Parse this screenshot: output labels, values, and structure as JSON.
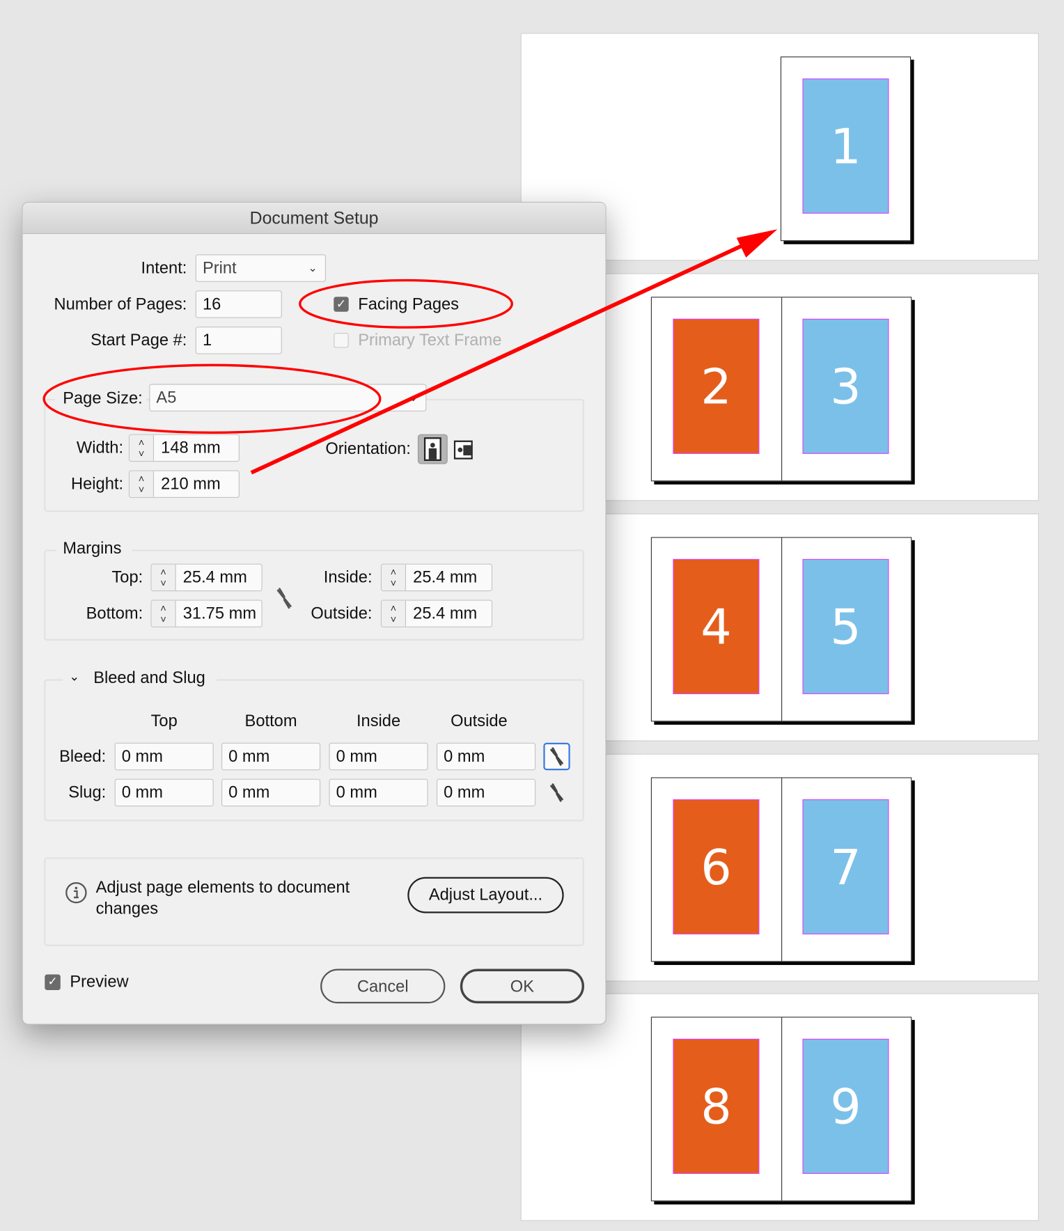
{
  "dialog": {
    "title": "Document Setup",
    "intent": {
      "label": "Intent:",
      "value": "Print"
    },
    "number_of_pages": {
      "label": "Number of Pages:",
      "value": "16"
    },
    "start_page": {
      "label": "Start Page #:",
      "value": "1"
    },
    "facing_pages": {
      "label": "Facing Pages",
      "checked": true
    },
    "primary_text_frame": {
      "label": "Primary Text Frame",
      "checked": false,
      "disabled": true
    },
    "page_size": {
      "label": "Page Size:",
      "value": "A5"
    },
    "width": {
      "label": "Width:",
      "value": "148 mm"
    },
    "height": {
      "label": "Height:",
      "value": "210 mm"
    },
    "orientation": {
      "label": "Orientation:",
      "selected": "portrait"
    },
    "margins": {
      "title": "Margins",
      "top": {
        "label": "Top:",
        "value": "25.4 mm"
      },
      "bottom": {
        "label": "Bottom:",
        "value": "31.75 mm"
      },
      "inside": {
        "label": "Inside:",
        "value": "25.4 mm"
      },
      "outside": {
        "label": "Outside:",
        "value": "25.4 mm"
      }
    },
    "bleed_slug": {
      "title": "Bleed and Slug",
      "columns": [
        "Top",
        "Bottom",
        "Inside",
        "Outside"
      ],
      "bleed": {
        "label": "Bleed:",
        "values": [
          "0 mm",
          "0 mm",
          "0 mm",
          "0 mm"
        ]
      },
      "slug": {
        "label": "Slug:",
        "values": [
          "0 mm",
          "0 mm",
          "0 mm",
          "0 mm"
        ]
      }
    },
    "adjust": {
      "line1": "Adjust page elements to document",
      "line2": "changes",
      "button": "Adjust Layout..."
    },
    "preview": {
      "label": "Preview",
      "checked": true
    },
    "cancel": "Cancel",
    "ok": "OK"
  },
  "pages_panel": {
    "spreads": [
      [
        "1"
      ],
      [
        "2",
        "3"
      ],
      [
        "4",
        "5"
      ],
      [
        "6",
        "7"
      ],
      [
        "8",
        "9"
      ]
    ],
    "colors": {
      "even": "#e55d1b",
      "odd": "#7bc0e9",
      "margin_guide": "#e040fb"
    }
  },
  "annotation_color": "#ff0000"
}
